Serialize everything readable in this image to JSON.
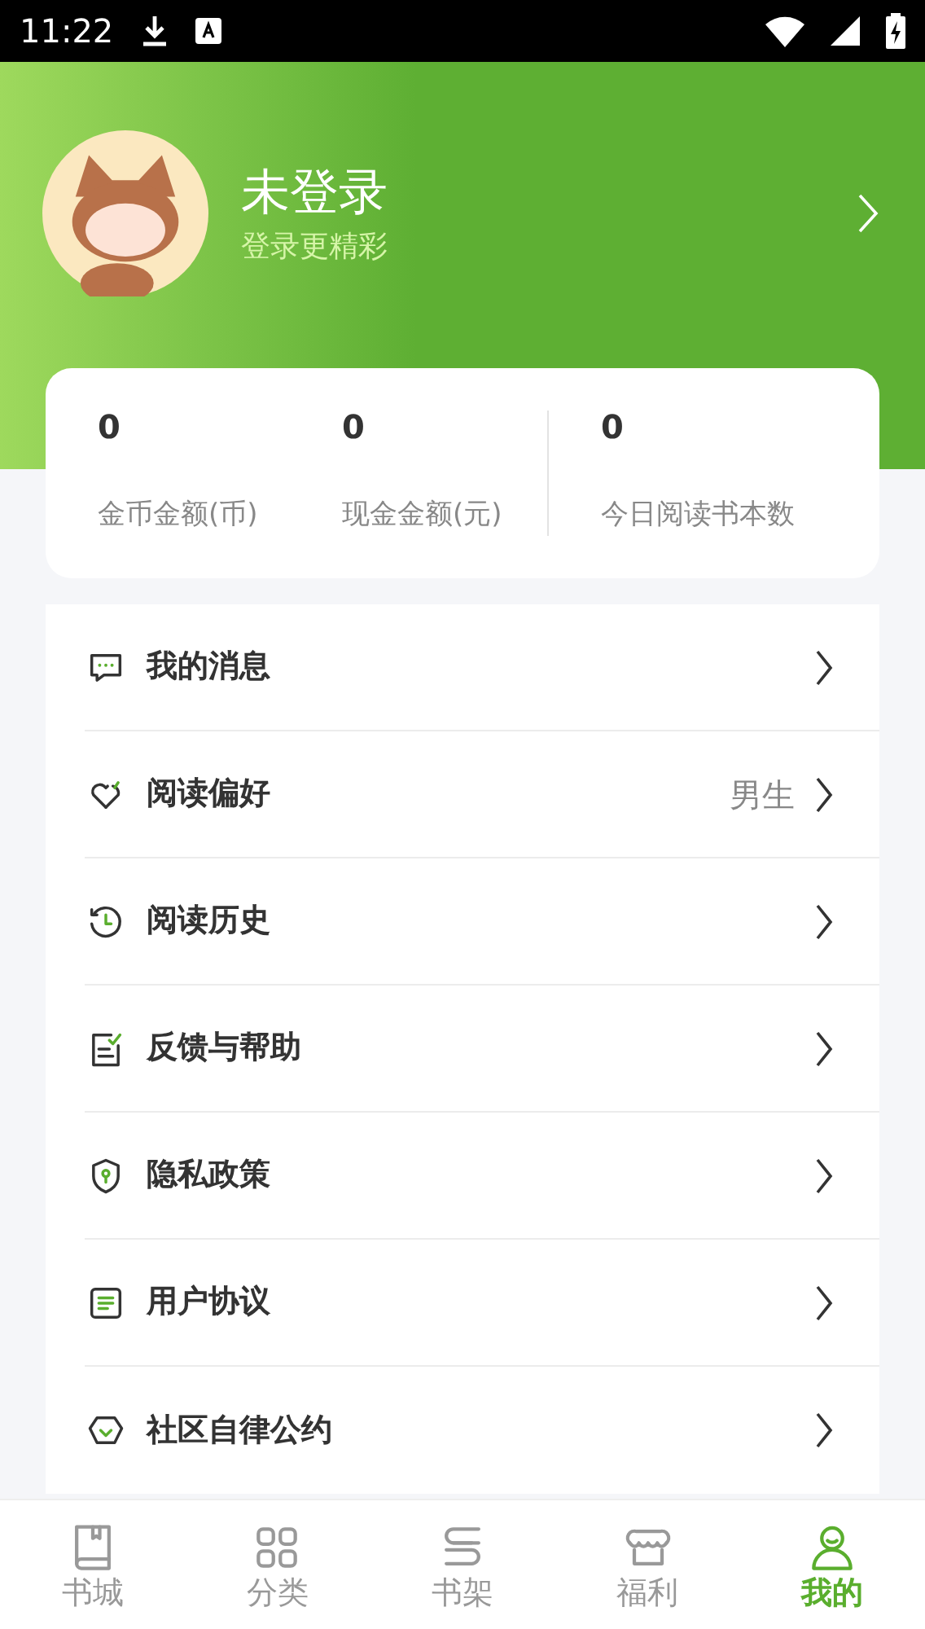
{
  "status_bar": {
    "time": "11:22"
  },
  "profile": {
    "name": "未登录",
    "subtitle": "登录更精彩"
  },
  "stats": [
    {
      "value": "0",
      "label": "金币金额(币)"
    },
    {
      "value": "0",
      "label": "现金金额(元)"
    },
    {
      "value": "0",
      "label": "今日阅读书本数"
    }
  ],
  "menu": [
    {
      "label": "我的消息"
    },
    {
      "label": "阅读偏好",
      "value": "男生"
    },
    {
      "label": "阅读历史"
    },
    {
      "label": "反馈与帮助"
    },
    {
      "label": "隐私政策"
    },
    {
      "label": "用户协议"
    },
    {
      "label": "社区自律公约"
    }
  ],
  "tabs": [
    {
      "label": "书城",
      "selected": false
    },
    {
      "label": "分类",
      "selected": false
    },
    {
      "label": "书架",
      "selected": false
    },
    {
      "label": "福利",
      "selected": false
    },
    {
      "label": "我的",
      "selected": true
    }
  ]
}
